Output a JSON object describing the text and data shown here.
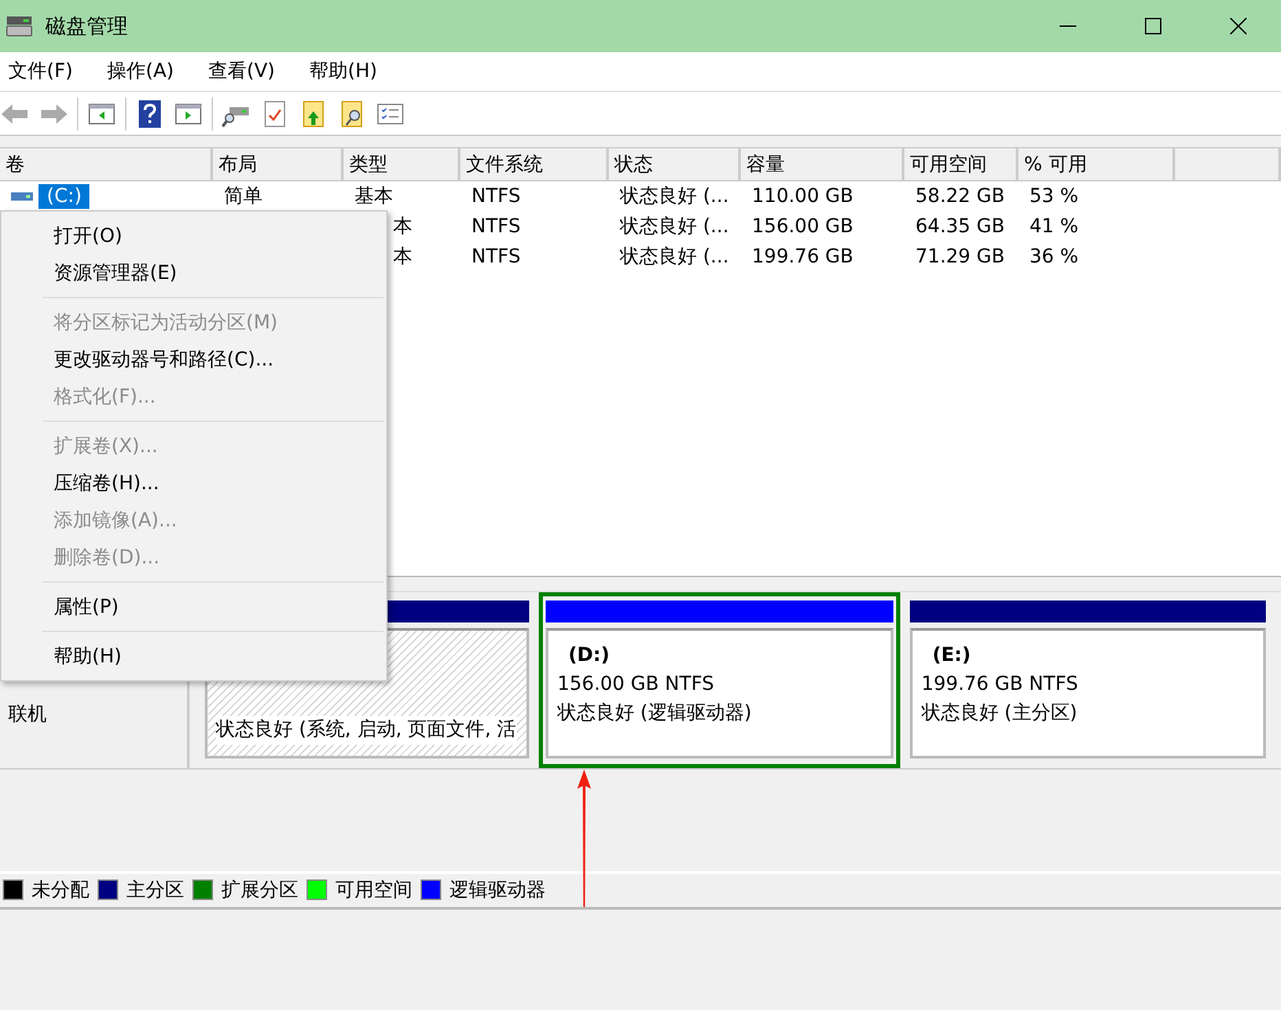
{
  "window": {
    "title": "磁盘管理"
  },
  "menu_bar": [
    "文件(F)",
    "操作(A)",
    "查看(V)",
    "帮助(H)"
  ],
  "table": {
    "columns": [
      "卷",
      "布局",
      "类型",
      "文件系统",
      "状态",
      "容量",
      "可用空间",
      "% 可用"
    ],
    "rows": [
      {
        "volume": "(C:)",
        "selected": true,
        "layout": "简单",
        "type": "基本",
        "fs": "NTFS",
        "status": "状态良好 (...",
        "capacity": "110.00 GB",
        "free": "58.22 GB",
        "pct": "53 %"
      },
      {
        "type": "本",
        "fs": "NTFS",
        "status": "状态良好 (...",
        "capacity": "156.00 GB",
        "free": "64.35 GB",
        "pct": "41 %"
      },
      {
        "type": "本",
        "fs": "NTFS",
        "status": "状态良好 (...",
        "capacity": "199.76 GB",
        "free": "71.29 GB",
        "pct": "36 %"
      }
    ]
  },
  "context_menu": [
    {
      "kind": "item",
      "label": "打开(O)",
      "disabled": false
    },
    {
      "kind": "item",
      "label": "资源管理器(E)",
      "disabled": false
    },
    {
      "kind": "separator"
    },
    {
      "kind": "item",
      "label": "将分区标记为活动分区(M)",
      "disabled": true
    },
    {
      "kind": "item",
      "label": "更改驱动器号和路径(C)...",
      "disabled": false
    },
    {
      "kind": "item",
      "label": "格式化(F)...",
      "disabled": true
    },
    {
      "kind": "separator"
    },
    {
      "kind": "item",
      "label": "扩展卷(X)...",
      "disabled": true
    },
    {
      "kind": "item",
      "label": "压缩卷(H)...",
      "disabled": false
    },
    {
      "kind": "item",
      "label": "添加镜像(A)...",
      "disabled": true
    },
    {
      "kind": "item",
      "label": "删除卷(D)...",
      "disabled": true
    },
    {
      "kind": "separator"
    },
    {
      "kind": "item",
      "label": "属性(P)",
      "disabled": false
    },
    {
      "kind": "separator"
    },
    {
      "kind": "item",
      "label": "帮助(H)",
      "disabled": false
    }
  ],
  "disk": {
    "status": "联机",
    "partitions": [
      {
        "kind": "hatched",
        "color": "#000080",
        "selected": false,
        "lines": [
          "状态良好 (系统, 启动, 页面文件, 活"
        ]
      },
      {
        "kind": "plain",
        "color": "#0000ff",
        "selected": true,
        "name": "(D:)",
        "lines": [
          "156.00 GB NTFS",
          "状态良好 (逻辑驱动器)"
        ]
      },
      {
        "kind": "plain",
        "color": "#000080",
        "selected": false,
        "name": "(E:)",
        "lines": [
          "199.76 GB NTFS",
          "状态良好 (主分区)"
        ]
      }
    ]
  },
  "legend": [
    {
      "label": "未分配",
      "color": "#000000"
    },
    {
      "label": "主分区",
      "color": "#000080"
    },
    {
      "label": "扩展分区",
      "color": "#008000"
    },
    {
      "label": "可用空间",
      "color": "#00ff00"
    },
    {
      "label": "逻辑驱动器",
      "color": "#0000ff"
    }
  ]
}
